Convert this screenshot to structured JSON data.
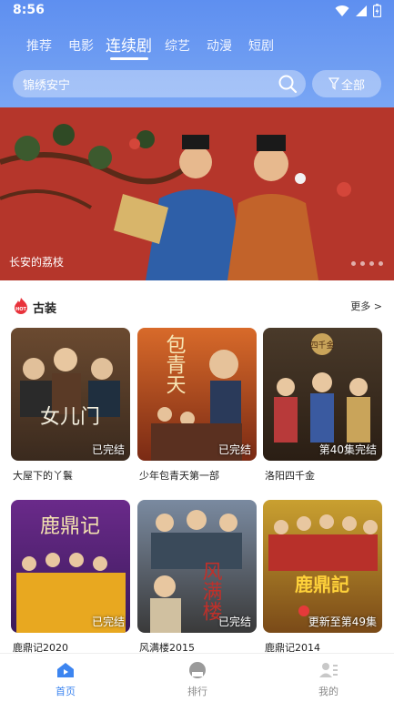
{
  "status": {
    "time": "8:56"
  },
  "tabs": [
    "推荐",
    "电影",
    "连续剧",
    "综艺",
    "动漫",
    "短剧"
  ],
  "search": {
    "query": "锦绣安宁",
    "filter_label": "全部"
  },
  "banner": {
    "title": "长安的荔枝"
  },
  "section": {
    "title": "古装",
    "more": "更多 >",
    "hot_badge": "HOT"
  },
  "shows": [
    {
      "title": "大屋下的丫鬟",
      "status": "已完结",
      "poster_text": "女儿门"
    },
    {
      "title": "少年包青天第一部",
      "status": "已完结",
      "poster_text": "包青天"
    },
    {
      "title": "洛阳四千金",
      "status": "第40集完结",
      "poster_text": "四千金"
    },
    {
      "title": "鹿鼎记2020",
      "status": "已完结",
      "poster_text": "鹿鼎记"
    },
    {
      "title": "风满楼2015",
      "status": "已完结",
      "poster_text": "风满楼"
    },
    {
      "title": "鹿鼎记2014",
      "status": "更新至第49集",
      "poster_text": "鹿鼎記"
    }
  ],
  "nav": [
    {
      "label": "首页",
      "icon": "home-icon",
      "active": true
    },
    {
      "label": "排行",
      "icon": "rank-icon",
      "active": false
    },
    {
      "label": "我的",
      "icon": "profile-icon",
      "active": false
    }
  ],
  "colors": {
    "accent": "#5e8ff0",
    "nav_active": "#3d85f0",
    "nav_inactive": "#8a8a8a"
  }
}
